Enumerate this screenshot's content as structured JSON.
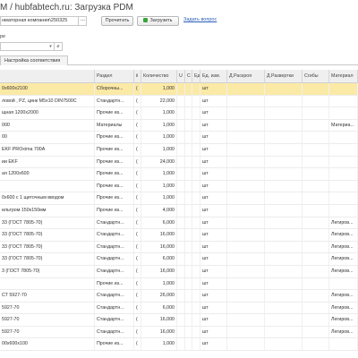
{
  "window": {
    "title": "М / hubfabtech.ru: Загрузка PDM"
  },
  "toolbar": {
    "file_value": "нматорная компания\\250325",
    "file_button": "...",
    "read_label": "Прочитать",
    "load_label": "Загрузить",
    "ask_link": "Задать вопрос"
  },
  "filter": {
    "label": "ре",
    "dropdown_glyph": "▾",
    "fx_glyph": "e"
  },
  "tabs": {
    "settings": "Настройка соответствия"
  },
  "table": {
    "columns": [
      "",
      "Раздел",
      "ii",
      "Количество",
      "U",
      "C",
      "Ед. и...",
      "Ед. изм.",
      "Д.Раскроя",
      "Д.Развертки",
      "Сгибы",
      "Материал"
    ],
    "rows": [
      {
        "name": "0х600х2100",
        "section": "Сборочны...",
        "i": "(",
        "qty": "1,000",
        "unit": "шт",
        "material": ""
      },
      {
        "name": "ловой , PZ, цинк М5х10 DIN7500C",
        "section": "Стандартн...",
        "i": "(",
        "qty": "22,000",
        "unit": "шт",
        "material": ""
      },
      {
        "name": "щная 1200х2000",
        "section": "Прочие из...",
        "i": "(",
        "qty": "1,000",
        "unit": "шт",
        "material": ""
      },
      {
        "name": "000",
        "section": "Материалы",
        "i": "(",
        "qty": "1,000",
        "unit": "шт",
        "material": "Материа..."
      },
      {
        "name": "00",
        "section": "Прочие из...",
        "i": "(",
        "qty": "1,000",
        "unit": "шт",
        "material": ""
      },
      {
        "name": "EKF PROxima 700A",
        "section": "Прочие из...",
        "i": "(",
        "qty": "1,000",
        "unit": "шт",
        "material": ""
      },
      {
        "name": "ии EKF",
        "section": "Прочие из...",
        "i": "(",
        "qty": "24,000",
        "unit": "шт",
        "material": ""
      },
      {
        "name": "ая 1200х600",
        "section": "Прочие из...",
        "i": "(",
        "qty": "1,000",
        "unit": "шт",
        "material": ""
      },
      {
        "name": "",
        "section": "Прочие из...",
        "i": "(",
        "qty": "1,000",
        "unit": "шт",
        "material": ""
      },
      {
        "name": "0х600 с 1 щеточным вводом",
        "section": "Прочие из...",
        "i": "(",
        "qty": "1,000",
        "unit": "шт",
        "material": ""
      },
      {
        "name": "ильтром 150х150мм",
        "section": "Прочие из...",
        "i": "(",
        "qty": "4,000",
        "unit": "шт",
        "material": ""
      },
      {
        "name": "33 (ГОСТ 7805-70)",
        "section": "Стандартн...",
        "i": "(",
        "qty": "6,000",
        "unit": "шт",
        "material": "Легиров..."
      },
      {
        "name": "33 (ГОСТ 7805-70)",
        "section": "Стандартн...",
        "i": "(",
        "qty": "16,000",
        "unit": "шт",
        "material": "Легиров..."
      },
      {
        "name": "33 (ГОСТ 7805-70)",
        "section": "Стандартн...",
        "i": "(",
        "qty": "16,000",
        "unit": "шт",
        "material": "Легиров..."
      },
      {
        "name": "33 (ГОСТ 7805-70)",
        "section": "Стандартн...",
        "i": "(",
        "qty": "6,000",
        "unit": "шт",
        "material": "Легиров..."
      },
      {
        "name": "3 (ГОСТ 7805-70)",
        "section": "Стандартн...",
        "i": "(",
        "qty": "16,000",
        "unit": "шт",
        "material": "Легиров..."
      },
      {
        "name": "",
        "section": "Прочие из...",
        "i": "(",
        "qty": "1,000",
        "unit": "шт",
        "material": ""
      },
      {
        "name": "СТ 5927-70",
        "section": "Стандартн...",
        "i": "(",
        "qty": "26,000",
        "unit": "шт",
        "material": "Легиров..."
      },
      {
        "name": "5927-70",
        "section": "Стандартн...",
        "i": "(",
        "qty": "6,000",
        "unit": "шт",
        "material": "Легиров..."
      },
      {
        "name": "5927-70",
        "section": "Стандартн...",
        "i": "(",
        "qty": "16,000",
        "unit": "шт",
        "material": "Легиров..."
      },
      {
        "name": "5927-70",
        "section": "Стандартн...",
        "i": "(",
        "qty": "16,000",
        "unit": "шт",
        "material": "Легиров..."
      },
      {
        "name": "00х600х100",
        "section": "Прочие из...",
        "i": "(",
        "qty": "1,000",
        "unit": "шт",
        "material": ""
      }
    ]
  }
}
